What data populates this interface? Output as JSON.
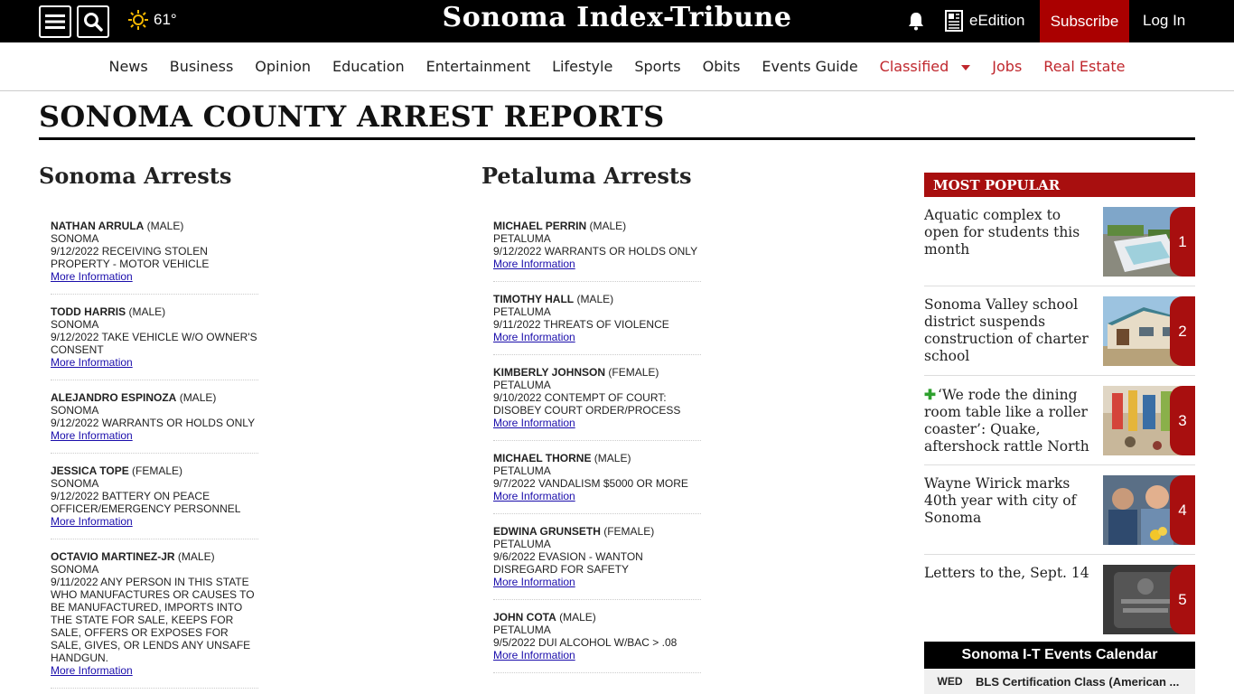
{
  "header": {
    "weather_temp": "61°",
    "logo": "Sonoma Index-Tribune",
    "edition_label": "eEdition",
    "subscribe_label": "Subscribe",
    "login_label": "Log In",
    "icons": [
      "menu-icon",
      "search-icon",
      "sun-icon",
      "bell-icon",
      "newspaper-icon"
    ]
  },
  "nav": {
    "items": [
      "News",
      "Business",
      "Opinion",
      "Education",
      "Entertainment",
      "Lifestyle",
      "Sports",
      "Obits",
      "Events Guide"
    ],
    "red_items": [
      "Classified",
      "Jobs",
      "Real Estate"
    ],
    "accent_color": "#c0272d"
  },
  "page": {
    "title": "SONOMA COUNTY ARREST REPORTS"
  },
  "sonoma": {
    "heading": "Sonoma Arrests",
    "entries": [
      {
        "name": "NATHAN ARRULA",
        "sex": " (MALE)",
        "city": "SONOMA",
        "charge": "9/12/2022 RECEIVING STOLEN PROPERTY - MOTOR VEHICLE",
        "link": "More Information"
      },
      {
        "name": "TODD HARRIS",
        "sex": " (MALE)",
        "city": "SONOMA",
        "charge": "9/12/2022 TAKE VEHICLE W/O OWNER'S CONSENT",
        "link": "More Information"
      },
      {
        "name": "ALEJANDRO ESPINOZA",
        "sex": " (MALE)",
        "city": "SONOMA",
        "charge": "9/12/2022 WARRANTS OR HOLDS ONLY",
        "link": "More Information"
      },
      {
        "name": "JESSICA TOPE",
        "sex": " (FEMALE)",
        "city": "SONOMA",
        "charge": "9/12/2022 BATTERY ON PEACE OFFICER/EMERGENCY PERSONNEL",
        "link": "More Information"
      },
      {
        "name": "OCTAVIO MARTINEZ-JR",
        "sex": " (MALE)",
        "city": "SONOMA",
        "charge": "9/11/2022 ANY PERSON IN THIS STATE WHO MANUFACTURES OR CAUSES TO BE MANUFACTURED, IMPORTS INTO THE STATE FOR SALE, KEEPS FOR SALE, OFFERS OR EXPOSES FOR SALE, GIVES, OR LENDS ANY UNSAFE HANDGUN.",
        "link": "More Information"
      }
    ]
  },
  "petaluma": {
    "heading": "Petaluma Arrests",
    "entries": [
      {
        "name": "MICHAEL PERRIN",
        "sex": " (MALE)",
        "city": "PETALUMA",
        "charge": "9/12/2022 WARRANTS OR HOLDS ONLY",
        "link": "More Information"
      },
      {
        "name": "TIMOTHY HALL",
        "sex": " (MALE)",
        "city": "PETALUMA",
        "charge": "9/11/2022 THREATS OF VIOLENCE",
        "link": "More Information"
      },
      {
        "name": "KIMBERLY JOHNSON",
        "sex": " (FEMALE)",
        "city": "PETALUMA",
        "charge": "9/10/2022 CONTEMPT OF COURT: DISOBEY COURT ORDER/PROCESS",
        "link": "More Information"
      },
      {
        "name": "MICHAEL THORNE",
        "sex": " (MALE)",
        "city": "PETALUMA",
        "charge": "9/7/2022 VANDALISM $5000 OR MORE",
        "link": "More Information"
      },
      {
        "name": "EDWINA GRUNSETH",
        "sex": " (FEMALE)",
        "city": "PETALUMA",
        "charge": "9/6/2022 EVASION - WANTON DISREGARD FOR SAFETY",
        "link": "More Information"
      },
      {
        "name": "JOHN COTA",
        "sex": " (MALE)",
        "city": "PETALUMA",
        "charge": "9/5/2022 DUI ALCOHOL W/BAC > .08",
        "link": "More Information"
      }
    ]
  },
  "sidebar": {
    "most_popular_heading": "MOST POPULAR",
    "items": [
      {
        "rank": "1",
        "title": "Aquatic complex to open for students this month",
        "plus": false
      },
      {
        "rank": "2",
        "title": "Sonoma Valley school district suspends construction of charter school",
        "plus": false
      },
      {
        "rank": "3",
        "title": "‘We rode the dining room table like a roller coaster’: Quake, aftershock rattle North",
        "plus": true
      },
      {
        "rank": "4",
        "title": "Wayne Wirick marks 40th year with city of Sonoma",
        "plus": false
      },
      {
        "rank": "5",
        "title": "Letters to the, Sept. 14",
        "plus": false
      }
    ],
    "events_heading": "Sonoma I-T Events Calendar",
    "event": {
      "day": "WED",
      "title": "BLS Certification Class (American ..."
    }
  }
}
